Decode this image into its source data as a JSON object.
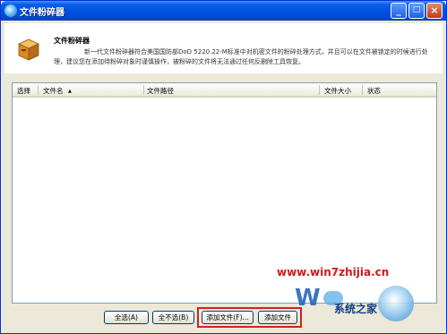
{
  "window": {
    "title": "文件粉碎器",
    "controls": {
      "minimize": "_",
      "maximize": "□",
      "close": "×"
    }
  },
  "header": {
    "title": "文件粉碎器",
    "description": "新一代文件粉碎器符合美国国防部DoD 5220.22-M标准中对机密文件的粉碎处理方式，并且可以在文件被锁定的时候进行处理，建议您在添加待粉碎对象时谨慎操作，被粉碎的文件将无法通过任何反删除工具恢复。"
  },
  "table": {
    "columns": {
      "select": "选择",
      "filename": "文件名",
      "sort_indicator": "▲",
      "path": "文件路径",
      "size": "文件大小",
      "status": "状态"
    },
    "rows": []
  },
  "buttons": {
    "select_all": "全选(A)",
    "select_none": "全不选(B)",
    "add_file": "添加文件(F)...",
    "add_folder": "添加文件"
  },
  "watermark": {
    "url": "www.win7zhijia.cn",
    "brand": "系统之家"
  }
}
